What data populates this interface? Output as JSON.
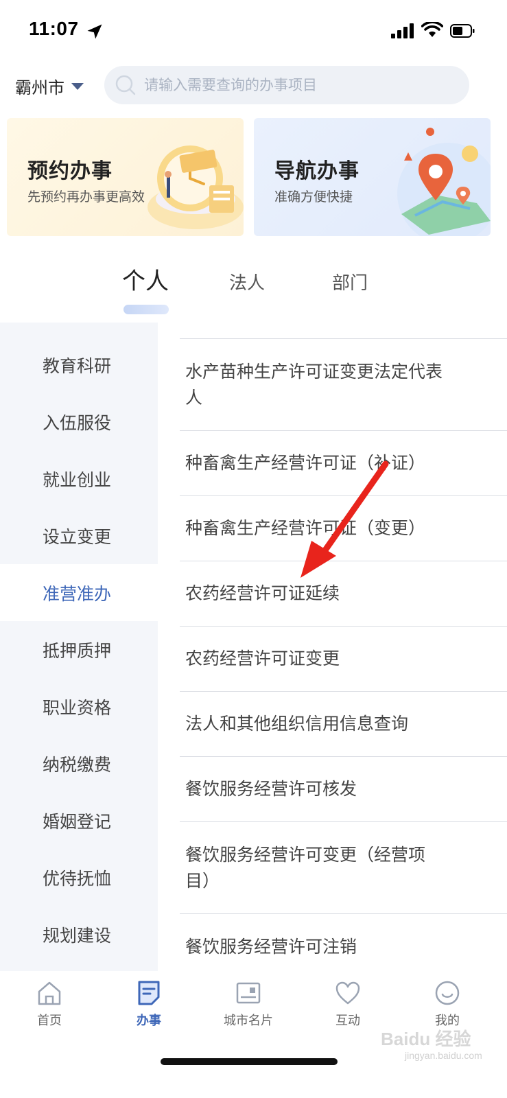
{
  "status_bar": {
    "time": "11:07"
  },
  "header": {
    "city": "霸州市",
    "search_placeholder": "请输入需要查询的办事项目"
  },
  "banners": [
    {
      "title": "预约办事",
      "subtitle": "先预约再办事更高效"
    },
    {
      "title": "导航办事",
      "subtitle": "准确方便快捷"
    }
  ],
  "category_tabs": [
    {
      "label": "个人",
      "active": true
    },
    {
      "label": "法人",
      "active": false
    },
    {
      "label": "部门",
      "active": false
    }
  ],
  "sidebar": {
    "items": [
      {
        "label": "教育科研"
      },
      {
        "label": "入伍服役"
      },
      {
        "label": "就业创业"
      },
      {
        "label": "设立变更"
      },
      {
        "label": "准营准办",
        "active": true
      },
      {
        "label": "抵押质押"
      },
      {
        "label": "职业资格"
      },
      {
        "label": "纳税缴费"
      },
      {
        "label": "婚姻登记"
      },
      {
        "label": "优待抚恤"
      },
      {
        "label": "规划建设"
      }
    ]
  },
  "services": {
    "items": [
      {
        "label": "水产苗种生产许可证变更法定代表人"
      },
      {
        "label": "种畜禽生产经营许可证（补证）"
      },
      {
        "label": "种畜禽生产经营许可证（变更）"
      },
      {
        "label": "农药经营许可证延续"
      },
      {
        "label": "农药经营许可证变更"
      },
      {
        "label": "法人和其他组织信用信息查询"
      },
      {
        "label": "餐饮服务经营许可核发"
      },
      {
        "label": "餐饮服务经营许可变更（经营项目）"
      },
      {
        "label": "餐饮服务经营许可注销"
      }
    ]
  },
  "bottom_nav": {
    "items": [
      {
        "label": "首页",
        "icon": "home-icon"
      },
      {
        "label": "办事",
        "icon": "document-icon",
        "active": true
      },
      {
        "label": "城市名片",
        "icon": "city-card-icon"
      },
      {
        "label": "互动",
        "icon": "heart-icon"
      },
      {
        "label": "我的",
        "icon": "smile-icon"
      }
    ]
  },
  "watermark": {
    "text": "Baidu 经验",
    "sub": "jingyan.baidu.com"
  },
  "colors": {
    "accent": "#3e67b8",
    "sidebar_bg": "#f4f6fa",
    "arrow": "#e8241c"
  }
}
